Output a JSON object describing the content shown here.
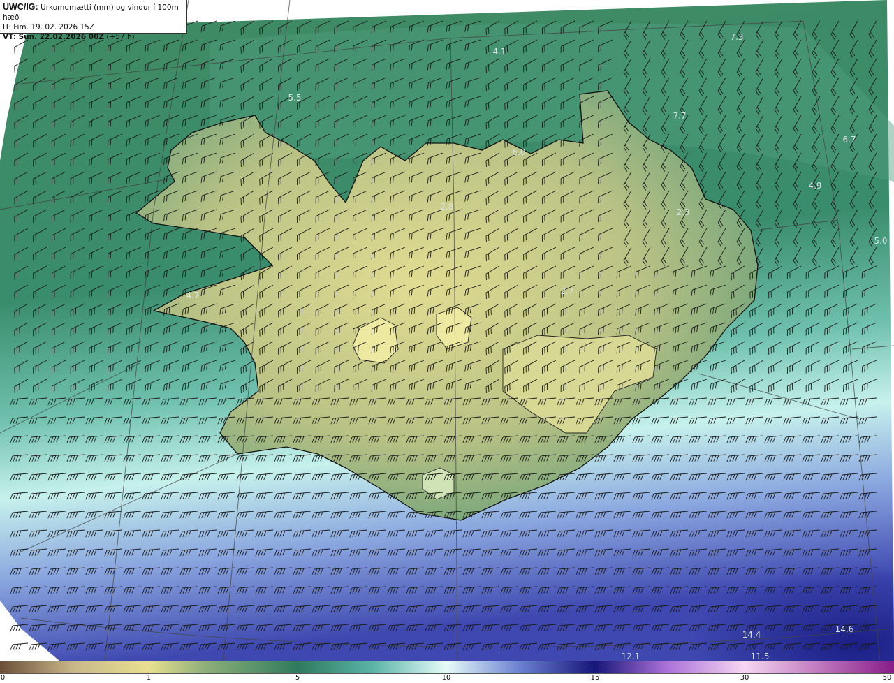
{
  "header": {
    "product": "UWC/IG:",
    "description": "Úrkomumætti (mm) og vindur í 100m hæð",
    "issue_time": "IT: Fim. 19. 02. 2026 15Z",
    "valid_label": "VT: Sun. 22.02.2026 00Z",
    "lead": "(+57 h)"
  },
  "value_labels": [
    {
      "id": "v1",
      "text": "7.3",
      "color": "#d8e4e8"
    },
    {
      "id": "v2",
      "text": "4.1",
      "color": "#d8e4e8"
    },
    {
      "id": "v3",
      "text": "5.5",
      "color": "#d8e4e8"
    },
    {
      "id": "v4",
      "text": "7.7",
      "color": "#d8e4e8"
    },
    {
      "id": "v5",
      "text": "6.7",
      "color": "#d8e4e8"
    },
    {
      "id": "v6",
      "text": "6.0",
      "color": "#d8e4e8"
    },
    {
      "id": "v7",
      "text": "4.9",
      "color": "#d8e4e8"
    },
    {
      "id": "v8",
      "text": "2.8",
      "color": "#d8e4e8"
    },
    {
      "id": "v9",
      "text": "2.3",
      "color": "#d8e4e8"
    },
    {
      "id": "v10",
      "text": "5.0",
      "color": "#d8e4e8"
    },
    {
      "id": "v11",
      "text": "4.7",
      "color": "#d8e4e8"
    },
    {
      "id": "v12",
      "text": "2.7",
      "color": "#d8e4e8"
    },
    {
      "id": "v13",
      "text": "14.4",
      "color": "#d8e4e8"
    },
    {
      "id": "v14",
      "text": "14.6",
      "color": "#d8e4e8"
    },
    {
      "id": "v15",
      "text": "12.1",
      "color": "#d8e4e8"
    },
    {
      "id": "v16",
      "text": "11.5",
      "color": "#d8e4e8"
    }
  ],
  "colorbar": {
    "ticks": [
      "0",
      "1",
      "5",
      "10",
      "15",
      "30",
      "50"
    ],
    "stops": [
      {
        "value": 0,
        "color": "#6b4f3a"
      },
      {
        "value": 0.5,
        "color": "#c9b98a"
      },
      {
        "value": 1,
        "color": "#e8e08f"
      },
      {
        "value": 2.5,
        "color": "#8fb07a"
      },
      {
        "value": 5,
        "color": "#2f7a5e"
      },
      {
        "value": 7.5,
        "color": "#5ab3a6"
      },
      {
        "value": 10,
        "color": "#e6fbf8"
      },
      {
        "value": 12.5,
        "color": "#6a7fd0"
      },
      {
        "value": 15,
        "color": "#16167a"
      },
      {
        "value": 22,
        "color": "#a86fd6"
      },
      {
        "value": 30,
        "color": "#f6d6f2"
      },
      {
        "value": 50,
        "color": "#8a1f8a"
      }
    ]
  },
  "map_colors": {
    "ocean_north": "#3b8a66",
    "land_low": "#c7c98a",
    "land_high": "#e3df93",
    "ocean_south": "#bfeeea",
    "ocean_far_south": "#4a56b8",
    "coast": "#111111",
    "grid": "#444444",
    "barb": "#1a1a1a"
  }
}
